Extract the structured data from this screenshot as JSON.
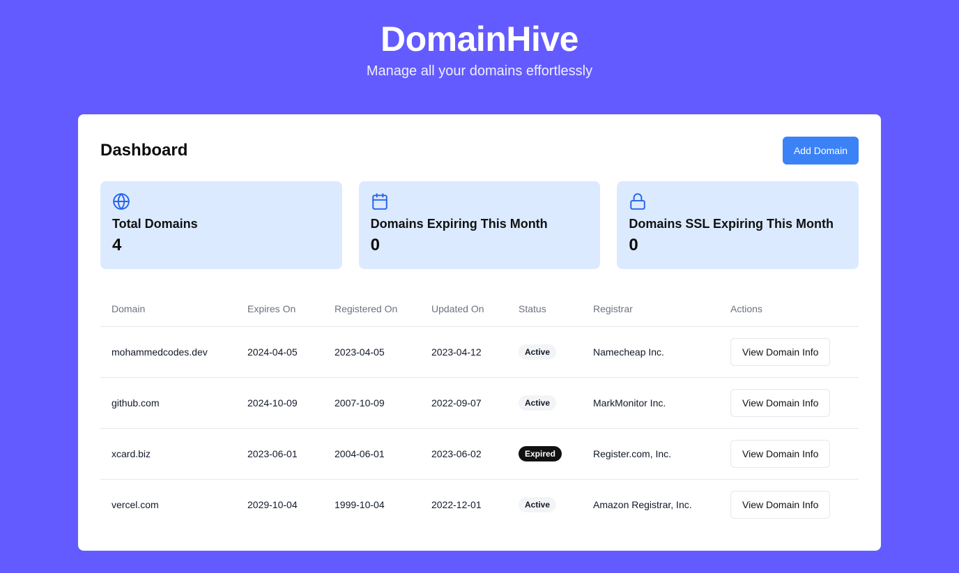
{
  "header": {
    "brand": "DomainHive",
    "tagline": "Manage all your domains effortlessly"
  },
  "dashboard": {
    "title": "Dashboard",
    "add_button_label": "Add Domain"
  },
  "stats": [
    {
      "icon": "globe-icon",
      "label": "Total Domains",
      "value": "4"
    },
    {
      "icon": "calendar-icon",
      "label": "Domains Expiring This Month",
      "value": "0"
    },
    {
      "icon": "lock-icon",
      "label": "Domains SSL Expiring This Month",
      "value": "0"
    }
  ],
  "table": {
    "columns": [
      "Domain",
      "Expires On",
      "Registered On",
      "Updated On",
      "Status",
      "Registrar",
      "Actions"
    ],
    "rows": [
      {
        "domain": "mohammedcodes.dev",
        "expires": "2024-04-05",
        "registered": "2023-04-05",
        "updated": "2023-04-12",
        "status": "Active",
        "registrar": "Namecheap Inc.",
        "action": "View Domain Info"
      },
      {
        "domain": "github.com",
        "expires": "2024-10-09",
        "registered": "2007-10-09",
        "updated": "2022-09-07",
        "status": "Active",
        "registrar": "MarkMonitor Inc.",
        "action": "View Domain Info"
      },
      {
        "domain": "xcard.biz",
        "expires": "2023-06-01",
        "registered": "2004-06-01",
        "updated": "2023-06-02",
        "status": "Expired",
        "registrar": "Register.com, Inc.",
        "action": "View Domain Info"
      },
      {
        "domain": "vercel.com",
        "expires": "2029-10-04",
        "registered": "1999-10-04",
        "updated": "2022-12-01",
        "status": "Active",
        "registrar": "Amazon Registrar, Inc.",
        "action": "View Domain Info"
      }
    ]
  },
  "colors": {
    "background": "#635bff",
    "accent": "#3b82f6",
    "stat_card": "#dbeafe",
    "icon": "#2563eb"
  }
}
